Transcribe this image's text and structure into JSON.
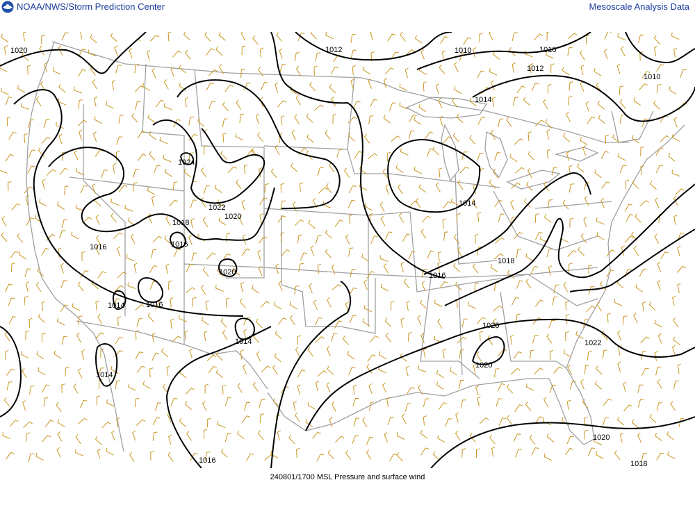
{
  "header": {
    "left_title": "NOAA/NWS/Storm Prediction Center",
    "right_title": "Mesoscale Analysis Data",
    "logo_icon": "noaa-logo-icon"
  },
  "caption": "240801/1700 MSL Pressure and surface wind",
  "colors": {
    "isobar": "#000000",
    "boundary": "#a0a0a0",
    "wind_barb": "#c8961e",
    "header_text": "#1a3a9c"
  },
  "isobar_labels": [
    {
      "id": "l01",
      "text": "1020"
    },
    {
      "id": "l02",
      "text": "1012"
    },
    {
      "id": "l03",
      "text": "1010"
    },
    {
      "id": "l04",
      "text": "1010"
    },
    {
      "id": "l05",
      "text": "1012"
    },
    {
      "id": "l06",
      "text": "1010"
    },
    {
      "id": "l07",
      "text": "1014"
    },
    {
      "id": "l08",
      "text": "1024"
    },
    {
      "id": "l09",
      "text": "1022"
    },
    {
      "id": "l10",
      "text": "1020"
    },
    {
      "id": "l11",
      "text": "1018"
    },
    {
      "id": "l12",
      "text": "1016"
    },
    {
      "id": "l13",
      "text": "1016"
    },
    {
      "id": "l14",
      "text": "1020"
    },
    {
      "id": "l15",
      "text": "1014"
    },
    {
      "id": "l16",
      "text": "1016"
    },
    {
      "id": "l17",
      "text": "1014"
    },
    {
      "id": "l18",
      "text": "1014"
    },
    {
      "id": "l19",
      "text": "1014"
    },
    {
      "id": "l20",
      "text": "1016"
    },
    {
      "id": "l21",
      "text": "1018"
    },
    {
      "id": "l22",
      "text": "1020"
    },
    {
      "id": "l23",
      "text": "1020"
    },
    {
      "id": "l24",
      "text": "1022"
    },
    {
      "id": "l25",
      "text": "1020"
    },
    {
      "id": "l26",
      "text": "1018"
    },
    {
      "id": "l27",
      "text": "1016"
    }
  ]
}
